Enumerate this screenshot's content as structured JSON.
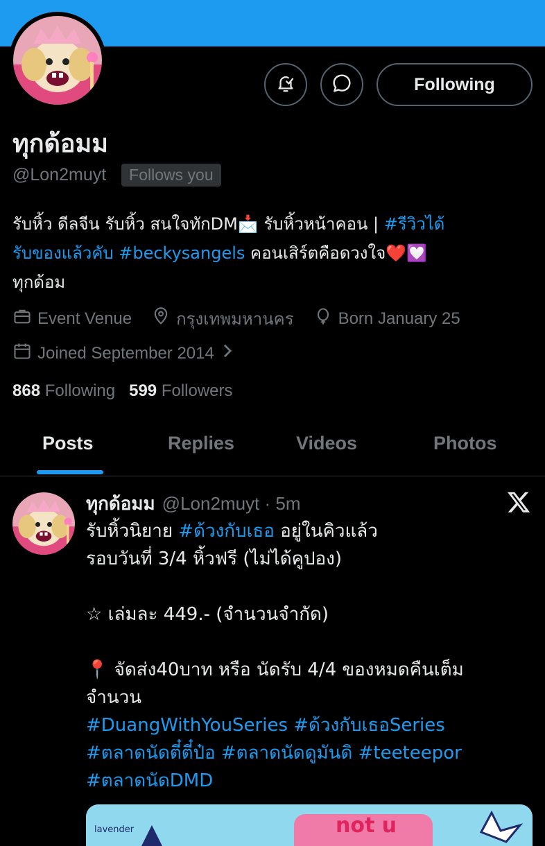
{
  "colors": {
    "banner": "#1d9bf0",
    "accent": "#1d9bf0",
    "background": "#000000",
    "text": "#e7e9ea",
    "muted": "#71767b"
  },
  "profile": {
    "display_name": "ทุกด้อมม",
    "handle": "@Lon2muyt",
    "follows_you": "Follows you",
    "follow_button": "Following",
    "notify_icon": "bell-check-icon",
    "message_icon": "message-bubble-icon",
    "bio": {
      "line1_text": "รับหิ้ว ดีลจีน รับหิ้ว สนใจทักDM",
      "line1_emoji": "📩",
      "line1_text2": " รับหิ้วหน้าคอน | ",
      "line1_link": "#รีวิวได้",
      "line2_link1": "รับของแล้วคับ",
      "line2_link2": "#beckysangels",
      "line2_text": " คอนเสิร์ตคือดวงใจ",
      "line2_emoji1": "❤️",
      "line2_emoji2": "💟",
      "line3_text": "ทุกด้อม"
    },
    "meta": {
      "category": "Event Venue",
      "location": "กรุงเทพมหานคร",
      "born": "Born January 25",
      "joined": "Joined September 2014"
    },
    "stats": {
      "following_count": "868",
      "following_label": "Following",
      "followers_count": "599",
      "followers_label": "Followers"
    }
  },
  "tabs": [
    "Posts",
    "Replies",
    "Videos",
    "Photos"
  ],
  "active_tab": "Posts",
  "post": {
    "name": "ทุกด้อมม",
    "handle_time": "@Lon2muyt · 5m",
    "source_icon": "x-logo-icon",
    "line1_text": "รับหิ้วนิยาย ",
    "line1_link": "#ด้วงกับเธอ",
    "line1_text2": " อยู่ในคิวแล้ว",
    "line2": "รอบวันที่ 3/4 หิ้วฟรี (ไม่ได้คูปอง)",
    "line3": "☆ เล่มละ 449.- (จำนวนจำกัด)",
    "line4_emoji": "📍",
    "line4_text": " จัดส่ง40บาท หรือ นัดรับ 4/4 ของหมดคืนเต็ม",
    "line5": "จำนวน",
    "hashtags1": "#DuangWithYouSeries #ด้วงกับเธอSeries",
    "hashtags2": "#ตลาดนัดตี๋ตี๋ป๋อ  #ตลาดนัดดูมันดิ #teeteepor",
    "hashtags3": "#ตลาดนัดDMD",
    "image_text_1": "lavender",
    "image_text_2": "not u"
  }
}
